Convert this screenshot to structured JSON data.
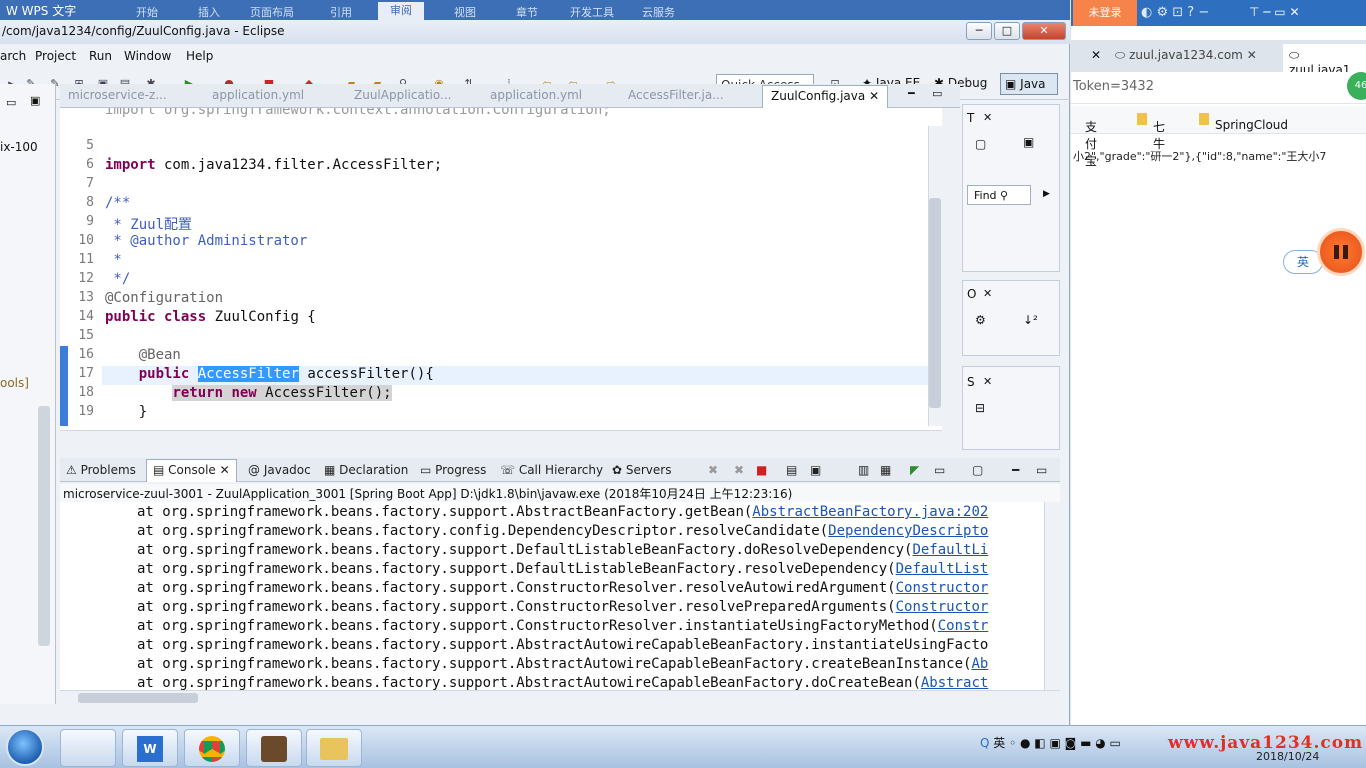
{
  "wps": {
    "logo": "W WPS 文字",
    "tabs": [
      "开始",
      "插入",
      "页面布局",
      "引用",
      "审阅",
      "视图",
      "章节",
      "开发工具",
      "云服务"
    ]
  },
  "eclipse": {
    "title": "/com/java1234/config/ZuulConfig.java - Eclipse",
    "menu": [
      "arch",
      "Project",
      "Run",
      "Window",
      "Help"
    ],
    "quick_access": "Quick Access",
    "perspectives": [
      "Java EE",
      "Debug",
      "Java"
    ],
    "left_panel": {
      "item1": "ix-100",
      "item2": "ools]"
    },
    "editor_tabs": [
      "microservice-z...",
      "application.yml",
      "ZuulApplicatio...",
      "application.yml",
      "AccessFilter.ja...",
      "ZuulConfig.java"
    ],
    "code": {
      "top_partial": "import org.springframework.context.annotation.Configuration;",
      "lines": [
        {
          "n": "5",
          "t": ""
        },
        {
          "n": "6",
          "t": "import com.java1234.filter.AccessFilter;"
        },
        {
          "n": "7",
          "t": ""
        },
        {
          "n": "8",
          "t": "/**"
        },
        {
          "n": "9",
          "t": " * Zuul配置"
        },
        {
          "n": "10",
          "t": " * @author Administrator"
        },
        {
          "n": "11",
          "t": " *"
        },
        {
          "n": "12",
          "t": " */"
        },
        {
          "n": "13",
          "t": "@Configuration"
        },
        {
          "n": "14",
          "t": "public class ZuulConfig {"
        },
        {
          "n": "15",
          "t": ""
        },
        {
          "n": "16",
          "t": "    @Bean"
        },
        {
          "n": "17",
          "t": "    public AccessFilter accessFilter(){"
        },
        {
          "n": "18",
          "t": "        return new AccessFilter();"
        },
        {
          "n": "19",
          "t": "    }"
        }
      ]
    },
    "right_views": {
      "find": "Find",
      "view1": "T",
      "view2": "O",
      "view3": "S"
    },
    "console_tabs": [
      "Problems",
      "Console",
      "Javadoc",
      "Declaration",
      "Progress",
      "Call Hierarchy",
      "Servers"
    ],
    "console_header": "microservice-zuul-3001 - ZuulApplication_3001 [Spring Boot App] D:\\jdk1.8\\bin\\javaw.exe (2018年10月24日 上午12:23:16)",
    "console_lines": [
      {
        "t": "at org.springframework.beans.factory.support.AbstractBeanFactory.getBean(",
        "l": "AbstractBeanFactory.java:202"
      },
      {
        "t": "at org.springframework.beans.factory.config.DependencyDescriptor.resolveCandidate(",
        "l": "DependencyDescripto"
      },
      {
        "t": "at org.springframework.beans.factory.support.DefaultListableBeanFactory.doResolveDependency(",
        "l": "DefaultLi"
      },
      {
        "t": "at org.springframework.beans.factory.support.DefaultListableBeanFactory.resolveDependency(",
        "l": "DefaultList"
      },
      {
        "t": "at org.springframework.beans.factory.support.ConstructorResolver.resolveAutowiredArgument(",
        "l": "Constructor"
      },
      {
        "t": "at org.springframework.beans.factory.support.ConstructorResolver.resolvePreparedArguments(",
        "l": "Constructor"
      },
      {
        "t": "at org.springframework.beans.factory.support.ConstructorResolver.instantiateUsingFactoryMethod(",
        "l": "Constr"
      },
      {
        "t": "at org.springframework.beans.factory.support.AbstractAutowireCapableBeanFactory.instantiateUsingFacto",
        "l": ""
      },
      {
        "t": "at org.springframework.beans.factory.support.AbstractAutowireCapableBeanFactory.createBeanInstance(",
        "l": "Ab"
      },
      {
        "t": "at org.springframework.beans.factory.support.AbstractAutowireCapableBeanFactory.doCreateBean(",
        "l": "Abstract"
      }
    ]
  },
  "browser": {
    "not_logged": "未登录",
    "tabs": [
      "zuul.java1234.com",
      "zuul.java1"
    ],
    "address": "Token=3432",
    "bookmarks": [
      "支付宝",
      "七牛",
      "SpringCloud"
    ],
    "json_text": "小2\",\"grade\":\"研一2\"},{\"id\":8,\"name\":\"王大小7",
    "badge": "46",
    "ime": "英"
  },
  "taskbar": {
    "tray_text": "英",
    "watermark": "www.java1234.com",
    "date": "2018/10/24"
  },
  "colors": {
    "keyword": "#7f0055",
    "comment": "#3f5fbf",
    "selection": "#3399ff",
    "link": "#1a55b5",
    "wps_blue": "#3d6fb6",
    "not_logged_orange": "#f5834a"
  }
}
